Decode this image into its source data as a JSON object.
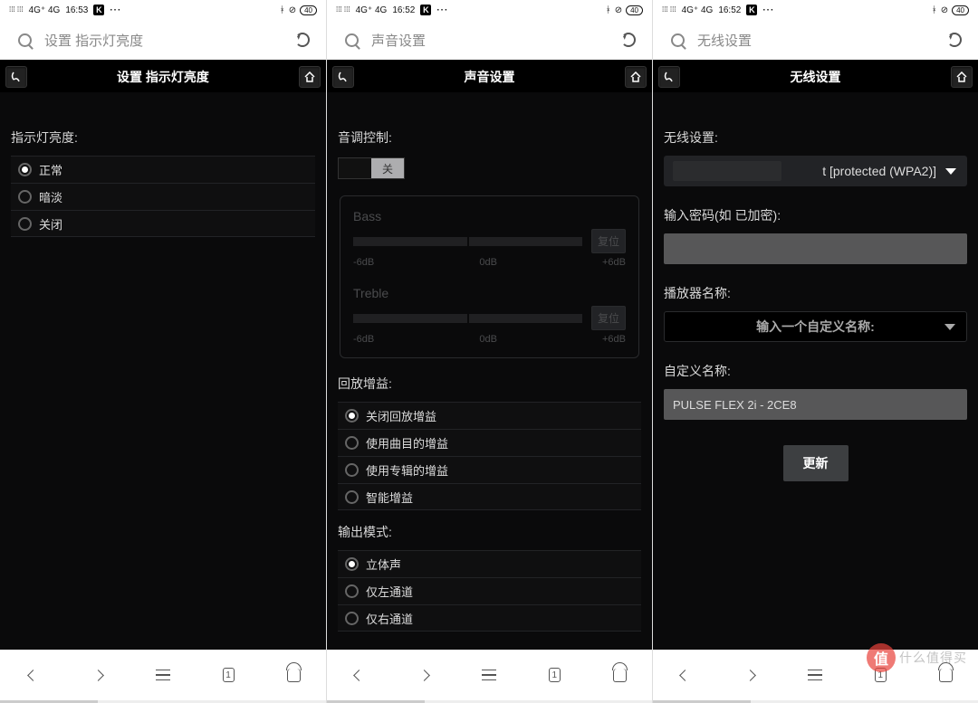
{
  "statusbar": {
    "signal": "4G⁺ 4G",
    "k": "K",
    "dots": "···",
    "bt": "ᚼ",
    "wifi": "⊗",
    "battery": "40"
  },
  "screen1": {
    "time": "16:53",
    "search": "设置 指示灯亮度",
    "appTitle": "设置 指示灯亮度",
    "sectionLabel": "指示灯亮度:",
    "options": [
      "正常",
      "暗淡",
      "关闭"
    ],
    "selected": 0
  },
  "screen2": {
    "time": "16:52",
    "search": "声音设置",
    "appTitle": "声音设置",
    "toneLabel": "音调控制:",
    "toggleOff": "关",
    "bassLabel": "Bass",
    "trebleLabel": "Treble",
    "reset": "复位",
    "ticks": {
      "min": "-6dB",
      "mid": "0dB",
      "max": "+6dB"
    },
    "gainLabel": "回放增益:",
    "gainOptions": [
      "关闭回放增益",
      "使用曲目的增益",
      "使用专辑的增益",
      "智能增益"
    ],
    "gainSelected": 0,
    "outputLabel": "输出模式:",
    "outputOptions": [
      "立体声",
      "仅左通道",
      "仅右通道"
    ],
    "outputSelected": 0
  },
  "screen3": {
    "time": "16:52",
    "search": "无线设置",
    "appTitle": "无线设置",
    "wifiLabel": "无线设置:",
    "networkSuffix": "t [protected (WPA2)]",
    "passwordLabel": "输入密码(如 已加密):",
    "playerLabel": "播放器名称:",
    "playerPlaceholder": "输入一个自定义名称:",
    "customLabel": "自定义名称:",
    "customValue": "PULSE FLEX 2i - 2CE8",
    "updateBtn": "更新"
  },
  "nav": {
    "tabCount": "1"
  },
  "watermark": {
    "badge": "值",
    "text": "什么值得买"
  }
}
